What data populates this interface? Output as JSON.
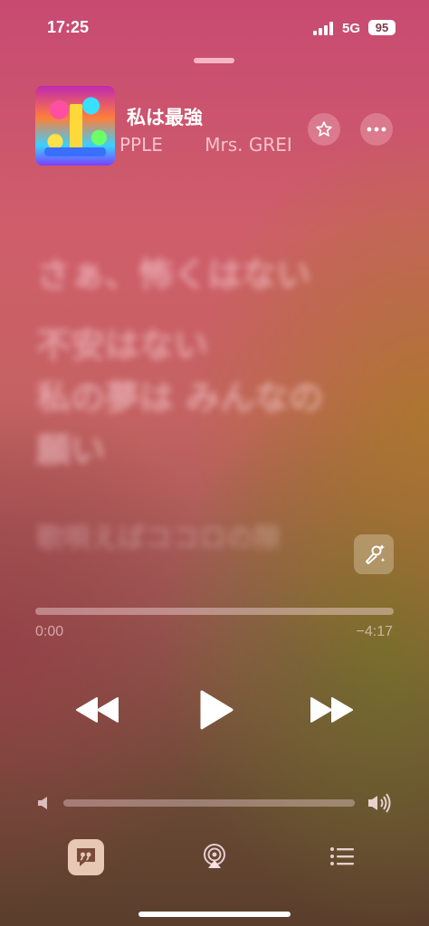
{
  "status_bar": {
    "time": "17:25",
    "network": "5G",
    "battery": "95"
  },
  "now_playing": {
    "title": "私は最強",
    "artist_scroll": [
      "PPLE",
      "Mrs. GREI"
    ],
    "album_art": "colorful-album-art"
  },
  "lyrics": [
    "さぁ、怖くはない",
    "不安はない",
    "私の夢は みんなの",
    "願い",
    "歌唄えばココロの隙"
  ],
  "playback": {
    "elapsed": "0:00",
    "remaining": "−4:17",
    "progress": 0,
    "volume": 0
  },
  "icons": {
    "favorite": "star-icon",
    "more": "ellipsis-icon",
    "sing": "microphone-sparkle-icon",
    "rewind": "rewind-icon",
    "play": "play-icon",
    "forward": "fast-forward-icon",
    "lyrics": "lyrics-quote-icon",
    "airplay": "airplay-icon",
    "queue": "queue-list-icon"
  },
  "colors": {
    "accent": "#ffffff",
    "lyrics_button_bg": "#e6c8b4"
  }
}
